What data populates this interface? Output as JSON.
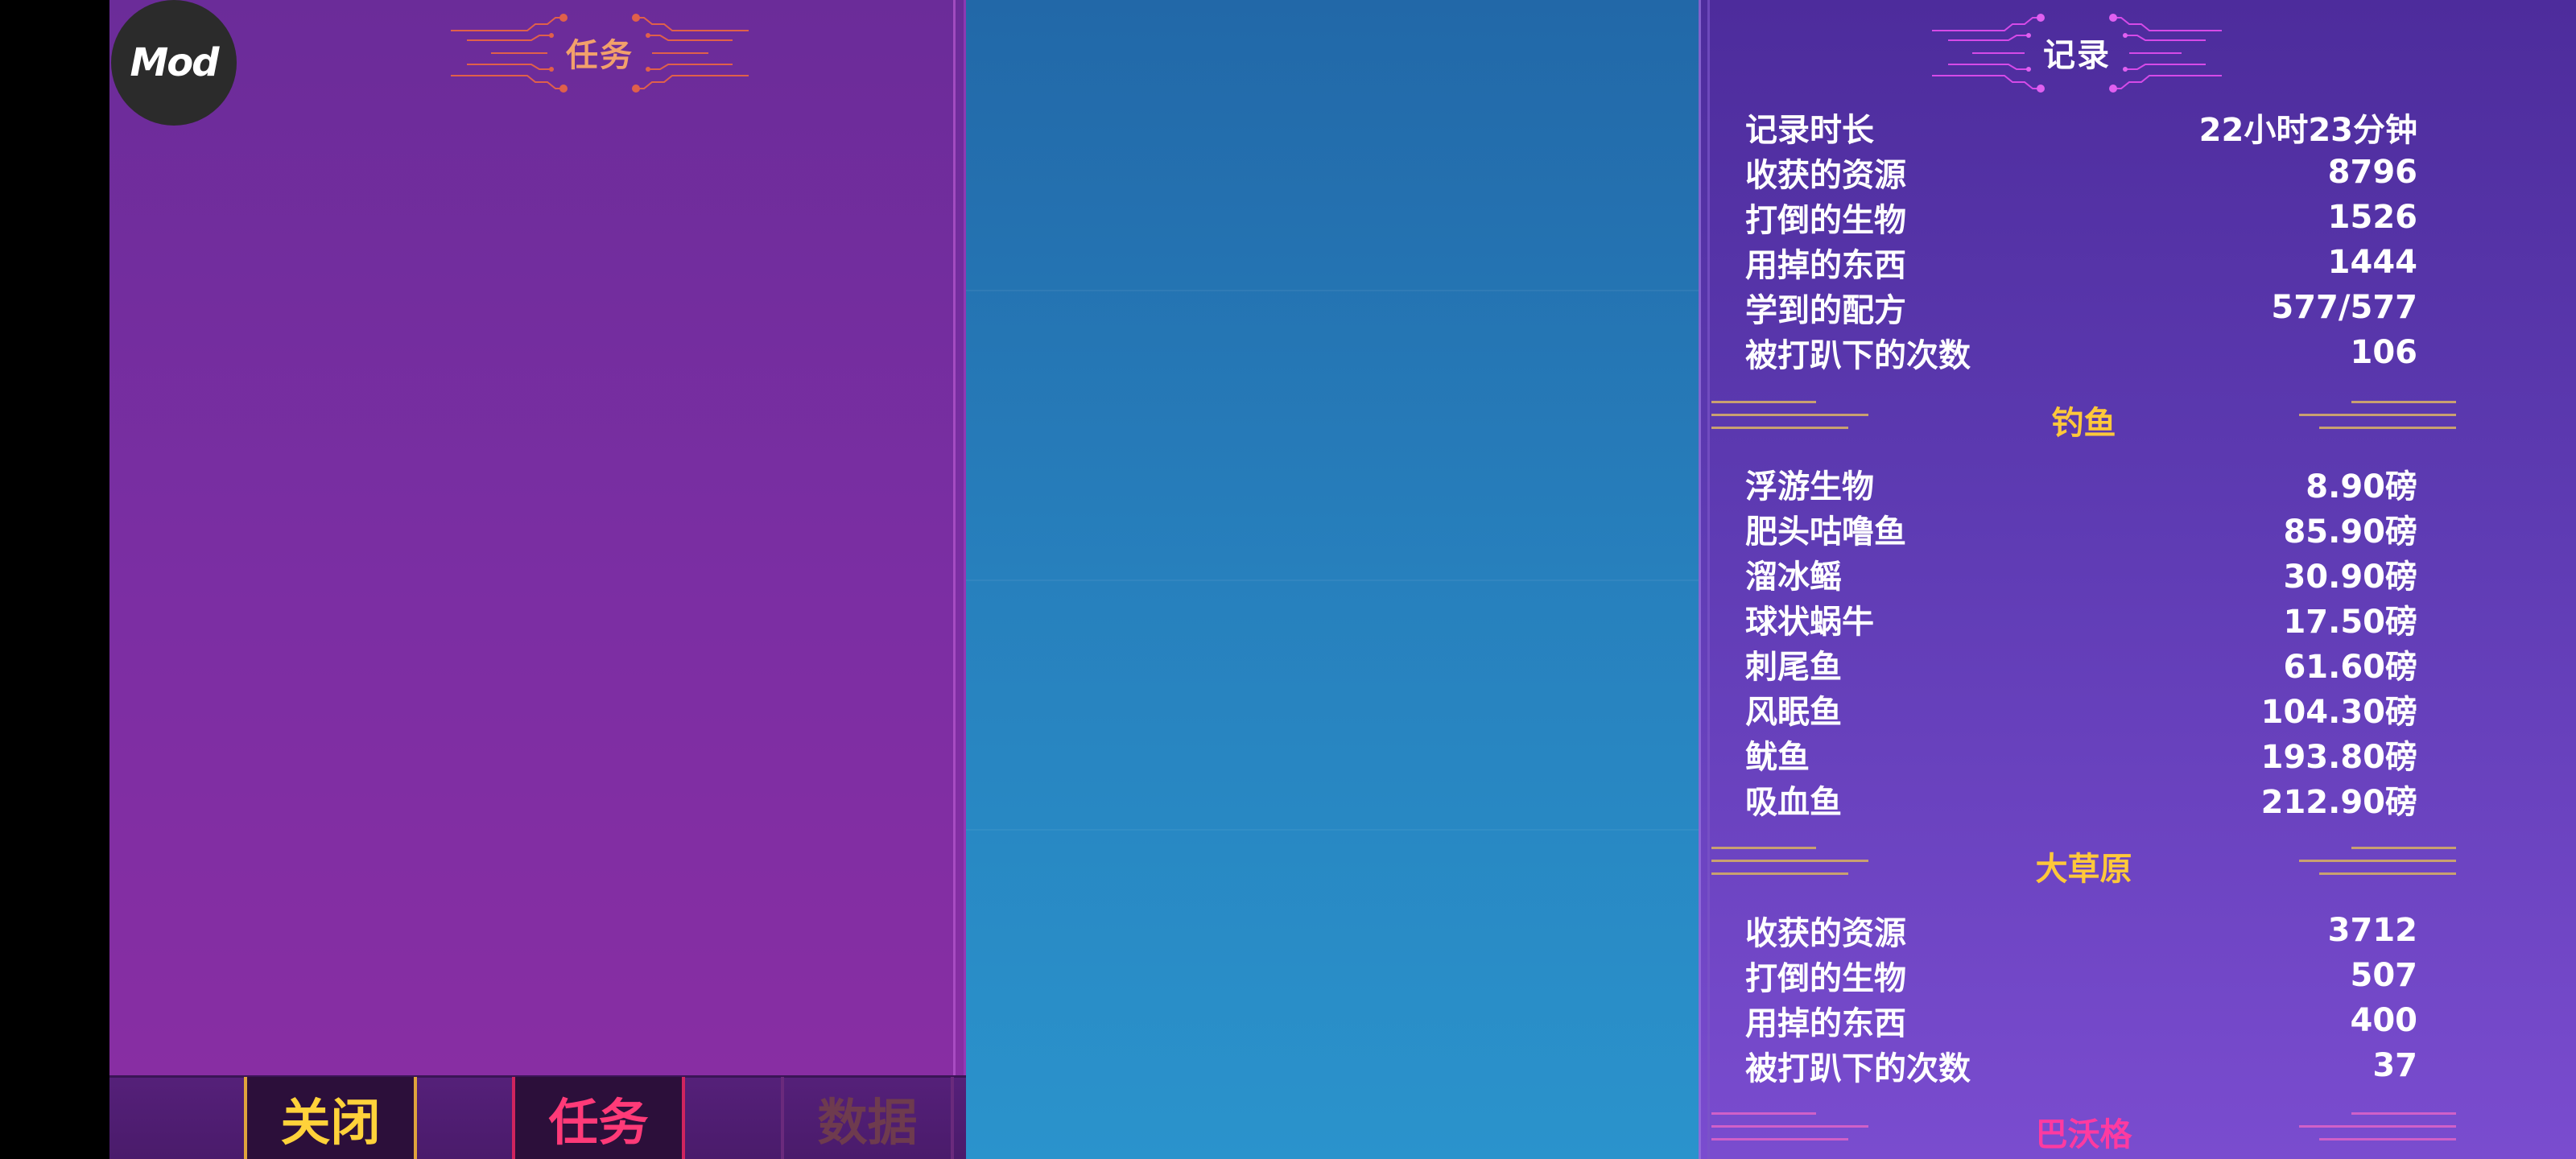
{
  "mod_badge": "Mod",
  "quest_panel": {
    "title": "任务",
    "tabs": {
      "close": "关闭",
      "quest": "任务",
      "data": "数据"
    }
  },
  "record_panel": {
    "title": "记录",
    "general": [
      {
        "label": "记录时长",
        "value": "22小时23分钟"
      },
      {
        "label": "收获的资源",
        "value": "8796"
      },
      {
        "label": "打倒的生物",
        "value": "1526"
      },
      {
        "label": "用掉的东西",
        "value": "1444"
      },
      {
        "label": "学到的配方",
        "value": "577/577"
      },
      {
        "label": "被打趴下的次数",
        "value": "106"
      }
    ],
    "fishing": {
      "title": "钓鱼",
      "items": [
        {
          "label": "浮游生物",
          "value": "8.90磅"
        },
        {
          "label": "肥头咕噜鱼",
          "value": "85.90磅"
        },
        {
          "label": "溜冰鳐",
          "value": "30.90磅"
        },
        {
          "label": "球状蜗牛",
          "value": "17.50磅"
        },
        {
          "label": "刺尾鱼",
          "value": "61.60磅"
        },
        {
          "label": "风眠鱼",
          "value": "104.30磅"
        },
        {
          "label": "鱿鱼",
          "value": "193.80磅"
        },
        {
          "label": "吸血鱼",
          "value": "212.90磅"
        }
      ]
    },
    "savanna": {
      "title": "大草原",
      "items": [
        {
          "label": "收获的资源",
          "value": "3712"
        },
        {
          "label": "打倒的生物",
          "value": "507"
        },
        {
          "label": "用掉的东西",
          "value": "400"
        },
        {
          "label": "被打趴下的次数",
          "value": "37"
        }
      ]
    },
    "next_section": {
      "title": "巴沃格"
    }
  },
  "colors": {
    "quest_title": "#f2a06b",
    "section_gold": "#ffc83a",
    "section_pink": "#ff3aa0",
    "tab_close": "#ffd23a",
    "tab_quest": "#ff3a78",
    "tab_data_inactive": "#6e3b4e"
  }
}
